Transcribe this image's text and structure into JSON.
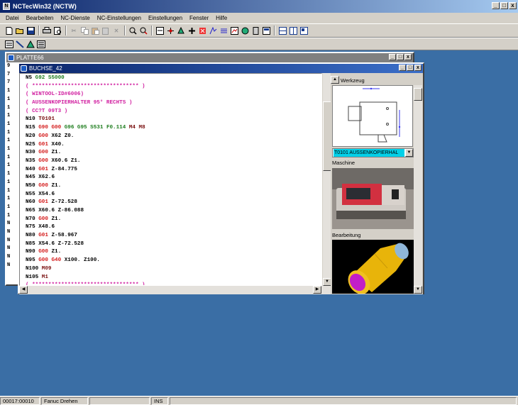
{
  "app": {
    "title": "NCTecWin32 (NCTW)",
    "menu": [
      "Datei",
      "Bearbeiten",
      "NC-Dienste",
      "NC-Einstellungen",
      "Einstellungen",
      "Fenster",
      "Hilfe"
    ],
    "window_buttons": [
      "_",
      "□",
      "x"
    ]
  },
  "toolbar1_icons": [
    "new-file-icon",
    "open-folder-icon",
    "save-icon",
    "sep",
    "print-icon",
    "print-preview-icon",
    "sep",
    "cut-icon",
    "copy-icon",
    "paste-icon",
    "paste-special-icon",
    "delete-icon",
    "sep",
    "find-icon",
    "find-replace-icon",
    "sep",
    "nc-tool-1-icon",
    "nc-tool-2-icon",
    "nc-tool-3-icon",
    "nc-tool-4-icon",
    "nc-tool-5-icon",
    "nc-tool-6-icon",
    "nc-tool-7-icon",
    "nc-tool-8-icon",
    "nc-tool-9-icon",
    "nc-tool-10-icon",
    "nc-tool-11-icon",
    "sep",
    "split-h-icon",
    "split-v-icon",
    "tile-icon"
  ],
  "outer_window": {
    "title": "PLATTE66",
    "left_gutter": [
      "9",
      "7",
      "7",
      "1",
      "1",
      "1",
      "1",
      "1",
      "1",
      "1",
      "1",
      "1",
      "1",
      "1",
      "1",
      "1",
      "1",
      "1",
      "1",
      "N",
      "N",
      "N",
      "N",
      "N",
      "N"
    ]
  },
  "inner_window": {
    "title": "BUCHSE_42",
    "code_lines": [
      [
        {
          "t": "N5 ",
          "c": "#000000"
        },
        {
          "t": "G92 S5000",
          "c": "#1e7d1e"
        }
      ],
      [
        {
          "t": "( ********************************* )",
          "c": "#d11fa0"
        }
      ],
      [
        {
          "t": "( WINTOOL-ID#6006)",
          "c": "#d11fa0"
        }
      ],
      [
        {
          "t": "( AUSSENKOPIERHALTER 95° RECHTS )",
          "c": "#d11fa0"
        }
      ],
      [
        {
          "t": "( CC?T 09T3 )",
          "c": "#d11fa0"
        }
      ],
      [
        {
          "t": "N10 ",
          "c": "#000000"
        },
        {
          "t": "T0101",
          "c": "#7a1010"
        }
      ],
      [
        {
          "t": "N15 ",
          "c": "#000000"
        },
        {
          "t": "G90 G00 ",
          "c": "#d41a1a"
        },
        {
          "t": "G96 G95 S531 F0.114 ",
          "c": "#1e7d1e"
        },
        {
          "t": "M4 M8",
          "c": "#7a1010"
        }
      ],
      [
        {
          "t": "N20 ",
          "c": "#000000"
        },
        {
          "t": "G00 ",
          "c": "#d41a1a"
        },
        {
          "t": "X62 Z0.",
          "c": "#000000"
        }
      ],
      [
        {
          "t": "N25 ",
          "c": "#000000"
        },
        {
          "t": "G01 ",
          "c": "#d41a1a"
        },
        {
          "t": "X40.",
          "c": "#000000"
        }
      ],
      [
        {
          "t": "N30 ",
          "c": "#000000"
        },
        {
          "t": "G00 ",
          "c": "#d41a1a"
        },
        {
          "t": "Z1.",
          "c": "#000000"
        }
      ],
      [
        {
          "t": "N35 ",
          "c": "#000000"
        },
        {
          "t": "G00 ",
          "c": "#d41a1a"
        },
        {
          "t": "X60.6 Z1.",
          "c": "#000000"
        }
      ],
      [
        {
          "t": "N40 ",
          "c": "#000000"
        },
        {
          "t": "G01 ",
          "c": "#d41a1a"
        },
        {
          "t": "Z-84.775",
          "c": "#000000"
        }
      ],
      [
        {
          "t": "N45 X62.6",
          "c": "#000000"
        }
      ],
      [
        {
          "t": "N50 ",
          "c": "#000000"
        },
        {
          "t": "G00 ",
          "c": "#d41a1a"
        },
        {
          "t": "Z1.",
          "c": "#000000"
        }
      ],
      [
        {
          "t": "N55 X54.6",
          "c": "#000000"
        }
      ],
      [
        {
          "t": "N60 ",
          "c": "#000000"
        },
        {
          "t": "G01 ",
          "c": "#d41a1a"
        },
        {
          "t": "Z-72.528",
          "c": "#000000"
        }
      ],
      [
        {
          "t": "N65 X60.6 Z-86.088",
          "c": "#000000"
        }
      ],
      [
        {
          "t": "N70 ",
          "c": "#000000"
        },
        {
          "t": "G00 ",
          "c": "#d41a1a"
        },
        {
          "t": "Z1.",
          "c": "#000000"
        }
      ],
      [
        {
          "t": "N75 X48.6",
          "c": "#000000"
        }
      ],
      [
        {
          "t": "N80 ",
          "c": "#000000"
        },
        {
          "t": "G01 ",
          "c": "#d41a1a"
        },
        {
          "t": "Z-58.967",
          "c": "#000000"
        }
      ],
      [
        {
          "t": "N85 X54.6 Z-72.528",
          "c": "#000000"
        }
      ],
      [
        {
          "t": "N90 ",
          "c": "#000000"
        },
        {
          "t": "G00 ",
          "c": "#d41a1a"
        },
        {
          "t": "Z1.",
          "c": "#000000"
        }
      ],
      [
        {
          "t": "N95 ",
          "c": "#000000"
        },
        {
          "t": "G00 G40 ",
          "c": "#d41a1a"
        },
        {
          "t": "X100. Z100.",
          "c": "#000000"
        }
      ],
      [
        {
          "t": "N100 ",
          "c": "#000000"
        },
        {
          "t": "M09",
          "c": "#7a1010"
        }
      ],
      [
        {
          "t": "N105 ",
          "c": "#000000"
        },
        {
          "t": "M1",
          "c": "#7a1010"
        }
      ],
      [
        {
          "t": "( ********************************* )",
          "c": "#d11fa0"
        }
      ]
    ],
    "side_panel": {
      "werkzeug_label": "Werkzeug",
      "tool_select": "T0101 AUSSENKOPIERHAL",
      "maschine_label": "Maschine",
      "bearbeitung_label": "Bearbeitung"
    }
  },
  "statusbar": {
    "position": "00017:00010",
    "control": "Fanuc Drehen",
    "blank": "",
    "mode": "INS"
  },
  "colors": {
    "desktop": "#3a6ea5",
    "title_active": "#0a246a",
    "title_inactive": "#808080",
    "accent_select": "#00d0e8"
  }
}
